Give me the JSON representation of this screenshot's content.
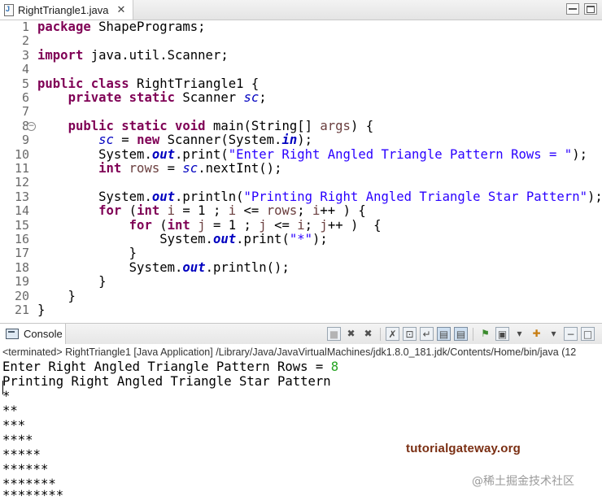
{
  "editor_tab": {
    "title": "RightTriangle1.java",
    "close": "✕"
  },
  "code": {
    "line_numbers": [
      "1",
      "2",
      "3",
      "4",
      "5",
      "6",
      "7",
      "8",
      "9",
      "10",
      "11",
      "12",
      "13",
      "14",
      "15",
      "16",
      "17",
      "18",
      "19",
      "20",
      "21"
    ],
    "l1": {
      "kw": "package",
      "rest": " ShapePrograms;"
    },
    "l3": {
      "kw": "import",
      "rest": " java.util.Scanner;"
    },
    "l5": {
      "kw": "public class",
      "rest": " RightTriangle1 {"
    },
    "l6": {
      "indent": "    ",
      "kw": "private static",
      "mid": " Scanner ",
      "field": "sc",
      "end": ";"
    },
    "l8": {
      "indent": "    ",
      "kw": "public static void",
      "rest": " main(String[] ",
      "param": "args",
      "end": ") {"
    },
    "l9": {
      "indent": "        ",
      "field": "sc",
      "eq": " = ",
      "kw": "new",
      "rest": " Scanner(System.",
      "sfield": "in",
      "end": ");"
    },
    "l10": {
      "indent": "        ",
      "pre": "System.",
      "sfield": "out",
      "mid": ".print(",
      "str": "\"Enter Right Angled Triangle Pattern Rows = \"",
      "end": ");"
    },
    "l11": {
      "indent": "        ",
      "kw": "int",
      "sp": " ",
      "var": "rows",
      "eq": " = ",
      "field": "sc",
      "end": ".nextInt();"
    },
    "l13": {
      "indent": "        ",
      "pre": "System.",
      "sfield": "out",
      "mid": ".println(",
      "str": "\"Printing Right Angled Triangle Star Pattern\"",
      "end": ");"
    },
    "l14": {
      "indent": "        ",
      "kw1": "for",
      "p1": " (",
      "kw2": "int",
      "sp": " ",
      "v1": "i",
      "p2": " = 1 ; ",
      "v2": "i",
      "p3": " <= ",
      "v3": "rows",
      "p4": "; ",
      "v4": "i",
      "end": "++ ) {"
    },
    "l15": {
      "indent": "            ",
      "kw1": "for",
      "p1": " (",
      "kw2": "int",
      "sp": " ",
      "v1": "j",
      "p2": " = 1 ; ",
      "v2": "j",
      "p3": " <= ",
      "v3": "i",
      "p4": "; ",
      "v4": "j",
      "end": "++ )  {"
    },
    "l16": {
      "indent": "                ",
      "pre": "System.",
      "sfield": "out",
      "mid": ".print(",
      "str": "\"*\"",
      "end": ");"
    },
    "l17": {
      "text": "            }"
    },
    "l18": {
      "indent": "            ",
      "pre": "System.",
      "sfield": "out",
      "end": ".println();"
    },
    "l19": {
      "text": "        }"
    },
    "l20": {
      "text": "    }"
    },
    "l21": {
      "text": "}"
    }
  },
  "console": {
    "tab_label": "Console",
    "terminated": "<terminated> RightTriangle1 [Java Application] /Library/Java/JavaVirtualMachines/jdk1.8.0_181.jdk/Contents/Home/bin/java  (12",
    "prompt": "Enter Right Angled Triangle Pattern Rows = ",
    "user_input": "8",
    "output_lines": [
      "Printing Right Angled Triangle Star Pattern",
      "*",
      "**",
      "***",
      "****",
      "*****",
      "******",
      "*******",
      "********"
    ]
  },
  "watermarks": {
    "site": "tutorialgateway.org",
    "juejin": "@稀土掘金技术社区"
  },
  "icons": {
    "tab": "java-file-icon",
    "console": "console-view-icon",
    "toolbar": [
      "terminate-icon",
      "remove-launch-icon",
      "remove-all-terminated-icon",
      "clear-console-icon",
      "scroll-lock-icon",
      "word-wrap-icon",
      "show-on-stdout-icon",
      "show-on-stderr-icon",
      "pin-console-icon",
      "display-console-icon",
      "open-console-icon",
      "minimize-icon",
      "maximize-icon"
    ]
  }
}
